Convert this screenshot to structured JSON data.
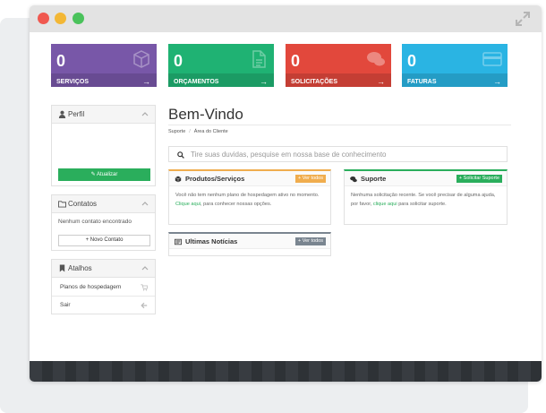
{
  "stats": [
    {
      "value": "0",
      "label": "SERVIÇOS",
      "arrow": "→",
      "color": "#7857a8",
      "icon": "cube-icon"
    },
    {
      "value": "0",
      "label": "ORÇAMENTOS",
      "arrow": "→",
      "color": "#1fb273",
      "icon": "document-icon"
    },
    {
      "value": "0",
      "label": "SOLICITAÇÕES",
      "arrow": "→",
      "color": "#e2483c",
      "icon": "chat-bubbles-icon"
    },
    {
      "value": "0",
      "label": "FATURAS",
      "arrow": "→",
      "color": "#2ab4e3",
      "icon": "credit-card-icon"
    }
  ],
  "sidebar": {
    "profile": {
      "title": "Perfil",
      "button": "Atualizar"
    },
    "contacts": {
      "title": "Contatos",
      "empty": "Nenhum contato encontrado",
      "button": "+ Novo Contato"
    },
    "shortcuts": {
      "title": "Atalhos",
      "items": [
        {
          "label": "Planos de hospedagem",
          "icon": "cart-icon"
        },
        {
          "label": "Sair",
          "icon": "arrow-left-icon"
        }
      ]
    }
  },
  "main": {
    "title": "Bem-Vindo",
    "breadcrumb": [
      "Suporte",
      "Área do Cliente"
    ],
    "breadcrumb_sep": "/",
    "search_placeholder": "Tire suas duvidas, pesquise em nossa base de conhecimento"
  },
  "cards": {
    "products": {
      "title": "Produtos/Serviços",
      "button": "+ Ver todos",
      "text_before": "Você não tem nenhum plano de hospedagem ativo no momento.",
      "link": "Clique aqui",
      "text_after": ", para conhecer nossas opções.",
      "accent": "#f0ad4e"
    },
    "support": {
      "title": "Suporte",
      "button": "+ Solicitar Suporte",
      "text_before": "Nenhuma solicitação recente. Se você precisar de alguma ajuda, por favor,",
      "link": "clique aqui",
      "text_after": " para solicitar suporte.",
      "accent": "#2aae5c"
    },
    "news": {
      "title": "Ultimas Notícias",
      "button": "+ Ver todos",
      "accent": "#7a8590"
    }
  }
}
